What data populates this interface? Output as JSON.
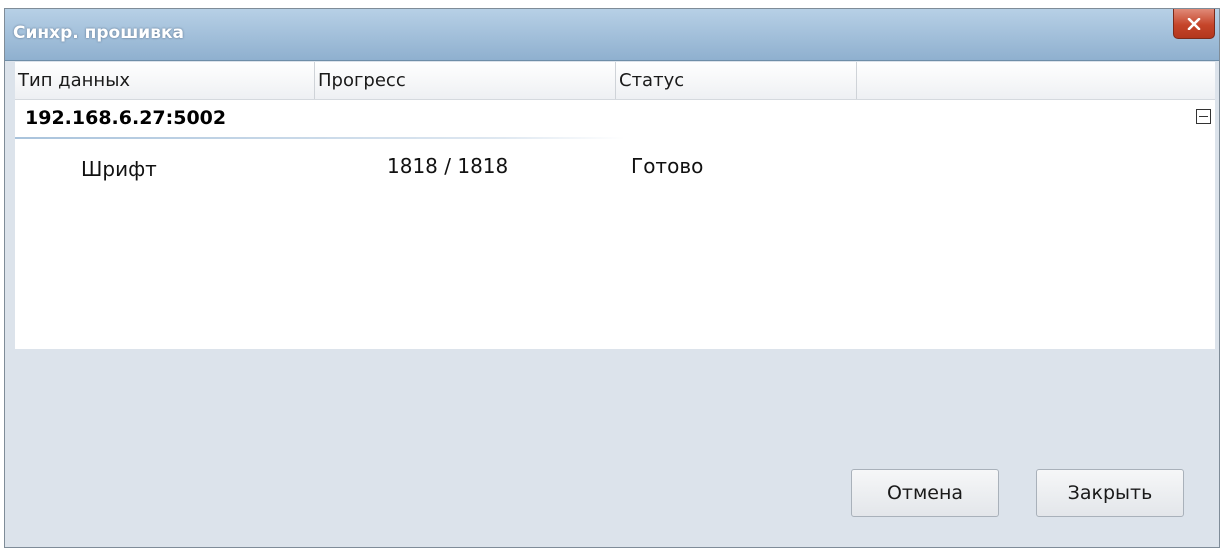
{
  "window": {
    "title": "Синхр. прошивка",
    "close_icon": "close-icon"
  },
  "grid": {
    "columns": [
      "Тип данных",
      "Прогресс",
      "Статус",
      ""
    ],
    "group": {
      "label": "192.168.6.27:5002",
      "toggle_icon": "collapse-minus-icon"
    },
    "rows": [
      {
        "type": "Шрифт",
        "progress": "1818 / 1818",
        "status": "Готово"
      }
    ]
  },
  "buttons": {
    "cancel_label": "Отмена",
    "close_label": "Закрыть"
  },
  "colors": {
    "titlebar": "#9fbcd8",
    "dialog_background": "#dce3eb",
    "close_button": "#c5452a"
  }
}
